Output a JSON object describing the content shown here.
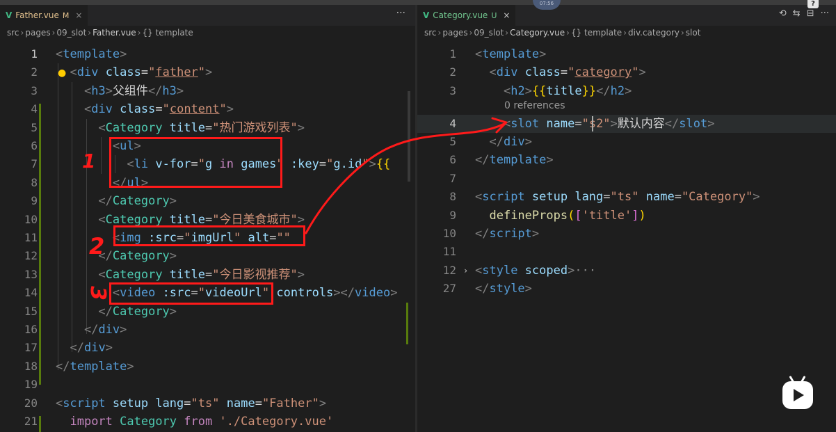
{
  "left": {
    "tab": {
      "name": "Father.vue",
      "status": "M",
      "close": "×"
    },
    "more": "···",
    "breadcrumb": [
      "src",
      "pages",
      "09_slot",
      "Father.vue",
      "{} template"
    ]
  },
  "right": {
    "tab": {
      "name": "Category.vue",
      "status": "U",
      "close": "×"
    },
    "actions": [
      "⟲",
      "⇆",
      "⊟",
      "···"
    ],
    "breadcrumb": [
      "src",
      "pages",
      "09_slot",
      "Category.vue",
      "{} template",
      "div.category",
      "slot"
    ],
    "codelens": "0 references"
  },
  "overlay": {
    "record_text": "07:56",
    "help_text": "?",
    "annot1": "1",
    "annot2": "2",
    "annot3": "3"
  },
  "left_lines": [
    {
      "n": "1",
      "t": [
        [
          "tg",
          "<"
        ],
        [
          "tn",
          "template"
        ],
        [
          "tg",
          ">"
        ]
      ]
    },
    {
      "n": "2",
      "t": [
        [
          "tx",
          "  "
        ],
        [
          "tg",
          "<"
        ],
        [
          "tn",
          "div "
        ],
        [
          "at",
          "class"
        ],
        [
          "tx",
          "="
        ],
        [
          "st",
          "\""
        ],
        [
          "stu",
          "father"
        ],
        [
          "st",
          "\""
        ],
        [
          "tg",
          ">"
        ]
      ]
    },
    {
      "n": "3",
      "t": [
        [
          "tx",
          "    "
        ],
        [
          "tg",
          "<"
        ],
        [
          "tn",
          "h3"
        ],
        [
          "tg",
          ">"
        ],
        [
          "tx",
          "父组件"
        ],
        [
          "tg",
          "</"
        ],
        [
          "tn",
          "h3"
        ],
        [
          "tg",
          ">"
        ]
      ]
    },
    {
      "n": "4",
      "t": [
        [
          "tx",
          "    "
        ],
        [
          "tg",
          "<"
        ],
        [
          "tn",
          "div "
        ],
        [
          "at",
          "class"
        ],
        [
          "tx",
          "="
        ],
        [
          "st",
          "\""
        ],
        [
          "stu",
          "content"
        ],
        [
          "st",
          "\""
        ],
        [
          "tg",
          ">"
        ]
      ]
    },
    {
      "n": "5",
      "t": [
        [
          "tx",
          "      "
        ],
        [
          "tg",
          "<"
        ],
        [
          "cp",
          "Category "
        ],
        [
          "at",
          "title"
        ],
        [
          "tx",
          "="
        ],
        [
          "st",
          "\"热门游戏列表\""
        ],
        [
          "tg",
          ">"
        ]
      ]
    },
    {
      "n": "6",
      "t": [
        [
          "tx",
          "        "
        ],
        [
          "tg",
          "<"
        ],
        [
          "tn",
          "ul"
        ],
        [
          "tg",
          ">"
        ]
      ]
    },
    {
      "n": "7",
      "t": [
        [
          "tx",
          "          "
        ],
        [
          "tg",
          "<"
        ],
        [
          "tn",
          "li "
        ],
        [
          "at",
          "v-for"
        ],
        [
          "tx",
          "="
        ],
        [
          "st",
          "\""
        ],
        [
          "at",
          "g "
        ],
        [
          "kw",
          "in "
        ],
        [
          "at",
          "games"
        ],
        [
          "st",
          "\""
        ],
        [
          "tx",
          " "
        ],
        [
          "at",
          ":key"
        ],
        [
          "tx",
          "="
        ],
        [
          "st",
          "\""
        ],
        [
          "at",
          "g.id"
        ],
        [
          "st",
          "\""
        ],
        [
          "tg",
          ">"
        ],
        [
          "br",
          "{{"
        ]
      ]
    },
    {
      "n": "8",
      "t": [
        [
          "tx",
          "        "
        ],
        [
          "tg",
          "</"
        ],
        [
          "tn",
          "ul"
        ],
        [
          "tg",
          ">"
        ]
      ]
    },
    {
      "n": "9",
      "t": [
        [
          "tx",
          "      "
        ],
        [
          "tg",
          "</"
        ],
        [
          "cp",
          "Category"
        ],
        [
          "tg",
          ">"
        ]
      ]
    },
    {
      "n": "10",
      "t": [
        [
          "tx",
          "      "
        ],
        [
          "tg",
          "<"
        ],
        [
          "cp",
          "Category "
        ],
        [
          "at",
          "title"
        ],
        [
          "tx",
          "="
        ],
        [
          "st",
          "\"今日美食城市\""
        ],
        [
          "tg",
          ">"
        ]
      ]
    },
    {
      "n": "11",
      "t": [
        [
          "tx",
          "        "
        ],
        [
          "tg",
          "<"
        ],
        [
          "tn",
          "img "
        ],
        [
          "at",
          ":src"
        ],
        [
          "tx",
          "="
        ],
        [
          "st",
          "\""
        ],
        [
          "at",
          "imgUrl"
        ],
        [
          "st",
          "\""
        ],
        [
          "tx",
          " "
        ],
        [
          "at",
          "alt"
        ],
        [
          "tx",
          "="
        ],
        [
          "st",
          "\"\""
        ]
      ]
    },
    {
      "n": "12",
      "t": [
        [
          "tx",
          "      "
        ],
        [
          "tg",
          "</"
        ],
        [
          "cp",
          "Category"
        ],
        [
          "tg",
          ">"
        ]
      ]
    },
    {
      "n": "13",
      "t": [
        [
          "tx",
          "      "
        ],
        [
          "tg",
          "<"
        ],
        [
          "cp",
          "Category "
        ],
        [
          "at",
          "title"
        ],
        [
          "tx",
          "="
        ],
        [
          "st",
          "\"今日影视推荐\""
        ],
        [
          "tg",
          ">"
        ]
      ]
    },
    {
      "n": "14",
      "t": [
        [
          "tx",
          "        "
        ],
        [
          "tg",
          "<"
        ],
        [
          "tn",
          "video "
        ],
        [
          "at",
          ":src"
        ],
        [
          "tx",
          "="
        ],
        [
          "st",
          "\""
        ],
        [
          "at",
          "videoUrl"
        ],
        [
          "st",
          "\""
        ],
        [
          "tx",
          " "
        ],
        [
          "at",
          "controls"
        ],
        [
          "tg",
          "></"
        ],
        [
          "tn",
          "video"
        ],
        [
          "tg",
          ">"
        ]
      ]
    },
    {
      "n": "15",
      "t": [
        [
          "tx",
          "      "
        ],
        [
          "tg",
          "</"
        ],
        [
          "cp",
          "Category"
        ],
        [
          "tg",
          ">"
        ]
      ]
    },
    {
      "n": "16",
      "t": [
        [
          "tx",
          "    "
        ],
        [
          "tg",
          "</"
        ],
        [
          "tn",
          "div"
        ],
        [
          "tg",
          ">"
        ]
      ]
    },
    {
      "n": "17",
      "t": [
        [
          "tx",
          "  "
        ],
        [
          "tg",
          "</"
        ],
        [
          "tn",
          "div"
        ],
        [
          "tg",
          ">"
        ]
      ]
    },
    {
      "n": "18",
      "t": [
        [
          "tg",
          "</"
        ],
        [
          "tn",
          "template"
        ],
        [
          "tg",
          ">"
        ]
      ]
    },
    {
      "n": "19",
      "t": []
    },
    {
      "n": "20",
      "t": [
        [
          "tg",
          "<"
        ],
        [
          "tn",
          "script "
        ],
        [
          "at",
          "setup "
        ],
        [
          "at",
          "lang"
        ],
        [
          "tx",
          "="
        ],
        [
          "st",
          "\"ts\""
        ],
        [
          "tx",
          " "
        ],
        [
          "at",
          "name"
        ],
        [
          "tx",
          "="
        ],
        [
          "st",
          "\"Father\""
        ],
        [
          "tg",
          ">"
        ]
      ]
    },
    {
      "n": "21",
      "t": [
        [
          "tx",
          "  "
        ],
        [
          "kw",
          "import "
        ],
        [
          "cp",
          "Category "
        ],
        [
          "kw",
          "from "
        ],
        [
          "st",
          "'./Category.vue'"
        ]
      ]
    }
  ],
  "right_lines": [
    {
      "n": "1",
      "t": [
        [
          "tg",
          "<"
        ],
        [
          "tn",
          "template"
        ],
        [
          "tg",
          ">"
        ]
      ]
    },
    {
      "n": "2",
      "t": [
        [
          "tx",
          "  "
        ],
        [
          "tg",
          "<"
        ],
        [
          "tn",
          "div "
        ],
        [
          "at",
          "class"
        ],
        [
          "tx",
          "="
        ],
        [
          "st",
          "\""
        ],
        [
          "stu",
          "category"
        ],
        [
          "st",
          "\""
        ],
        [
          "tg",
          ">"
        ]
      ]
    },
    {
      "n": "3",
      "t": [
        [
          "tx",
          "    "
        ],
        [
          "tg",
          "<"
        ],
        [
          "tn",
          "h2"
        ],
        [
          "tg",
          ">"
        ],
        [
          "br",
          "{{"
        ],
        [
          "at",
          "title"
        ],
        [
          "br",
          "}}"
        ],
        [
          "tg",
          "</"
        ],
        [
          "tn",
          "h2"
        ],
        [
          "tg",
          ">"
        ]
      ]
    },
    {
      "n": "4",
      "t": [
        [
          "tx",
          "    "
        ],
        [
          "tg",
          "<"
        ],
        [
          "tn",
          "slot "
        ],
        [
          "at",
          "name"
        ],
        [
          "tx",
          "="
        ],
        [
          "st",
          "\"s2\""
        ],
        [
          "tg",
          ">"
        ],
        [
          "tx",
          "默认内容"
        ],
        [
          "tg",
          "</"
        ],
        [
          "tn",
          "slot"
        ],
        [
          "tg",
          ">"
        ]
      ]
    },
    {
      "n": "5",
      "t": [
        [
          "tx",
          "  "
        ],
        [
          "tg",
          "</"
        ],
        [
          "tn",
          "div"
        ],
        [
          "tg",
          ">"
        ]
      ]
    },
    {
      "n": "6",
      "t": [
        [
          "tg",
          "</"
        ],
        [
          "tn",
          "template"
        ],
        [
          "tg",
          ">"
        ]
      ]
    },
    {
      "n": "7",
      "t": []
    },
    {
      "n": "8",
      "t": [
        [
          "tg",
          "<"
        ],
        [
          "tn",
          "script "
        ],
        [
          "at",
          "setup "
        ],
        [
          "at",
          "lang"
        ],
        [
          "tx",
          "="
        ],
        [
          "st",
          "\"ts\""
        ],
        [
          "tx",
          " "
        ],
        [
          "at",
          "name"
        ],
        [
          "tx",
          "="
        ],
        [
          "st",
          "\"Category\""
        ],
        [
          "tg",
          ">"
        ]
      ]
    },
    {
      "n": "9",
      "t": [
        [
          "tx",
          "  "
        ],
        [
          "fn",
          "defineProps"
        ],
        [
          "br",
          "("
        ],
        [
          "bp",
          "["
        ],
        [
          "st",
          "'title'"
        ],
        [
          "bp",
          "]"
        ],
        [
          "br",
          ")"
        ]
      ]
    },
    {
      "n": "10",
      "t": [
        [
          "tg",
          "</"
        ],
        [
          "tn",
          "script"
        ],
        [
          "tg",
          ">"
        ]
      ]
    },
    {
      "n": "11",
      "t": []
    },
    {
      "n": "12",
      "t": [
        [
          "tg",
          "<"
        ],
        [
          "tn",
          "style "
        ],
        [
          "at",
          "scoped"
        ],
        [
          "tg",
          ">"
        ],
        [
          "ell",
          "···"
        ]
      ]
    },
    {
      "n": "27",
      "t": [
        [
          "tg",
          "</"
        ],
        [
          "tn",
          "style"
        ],
        [
          "tg",
          ">"
        ]
      ]
    }
  ]
}
